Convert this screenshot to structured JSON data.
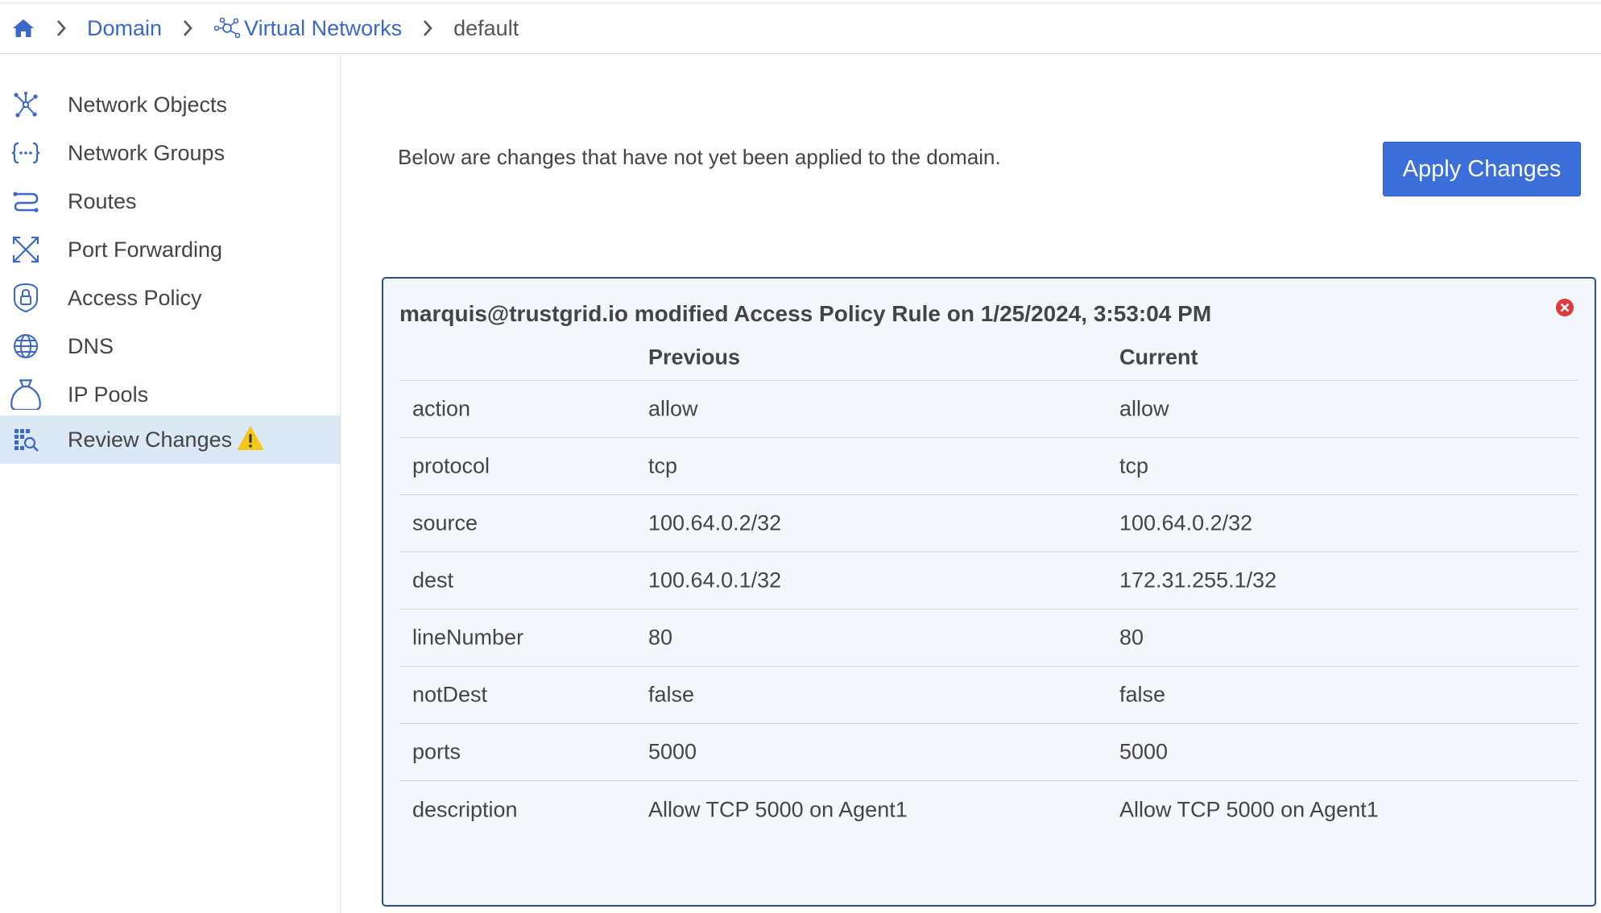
{
  "breadcrumb": {
    "items": [
      "Domain",
      "Virtual Networks",
      "default"
    ]
  },
  "sidebar": {
    "items": [
      {
        "label": "Network Objects",
        "icon": "network-objects-icon"
      },
      {
        "label": "Network Groups",
        "icon": "network-groups-icon"
      },
      {
        "label": "Routes",
        "icon": "routes-icon"
      },
      {
        "label": "Port Forwarding",
        "icon": "port-forwarding-icon"
      },
      {
        "label": "Access Policy",
        "icon": "access-policy-lock-icon"
      },
      {
        "label": "DNS",
        "icon": "globe-icon"
      },
      {
        "label": "IP Pools",
        "icon": "ip-pools-bag-icon"
      },
      {
        "label": "Review Changes",
        "icon": "review-changes-icon",
        "active": true,
        "warning": true
      }
    ]
  },
  "main": {
    "notice": "Below are changes that have not yet been applied to the domain.",
    "apply_label": "Apply Changes"
  },
  "change": {
    "title": "marquis@trustgrid.io modified Access Policy Rule on 1/25/2024, 3:53:04 PM",
    "columns": [
      "",
      "Previous",
      "Current"
    ],
    "rows": [
      {
        "field": "action",
        "previous": "allow",
        "current": "allow"
      },
      {
        "field": "protocol",
        "previous": "tcp",
        "current": "tcp"
      },
      {
        "field": "source",
        "previous": "100.64.0.2/32",
        "current": "100.64.0.2/32"
      },
      {
        "field": "dest",
        "previous": "100.64.0.1/32",
        "current": "172.31.255.1/32"
      },
      {
        "field": "lineNumber",
        "previous": "80",
        "current": "80"
      },
      {
        "field": "notDest",
        "previous": "false",
        "current": "false"
      },
      {
        "field": "ports",
        "previous": "5000",
        "current": "5000"
      },
      {
        "field": "description",
        "previous": "Allow TCP 5000 on Agent1",
        "current": "Allow TCP 5000 on Agent1"
      }
    ]
  },
  "colors": {
    "accent": "#3d6fdb",
    "link": "#3b67c9",
    "active_bg": "#dbe8f6",
    "card_border": "#2c5282",
    "card_bg": "#f3f7fb",
    "warning": "#f5c518",
    "close": "#e0393e"
  }
}
